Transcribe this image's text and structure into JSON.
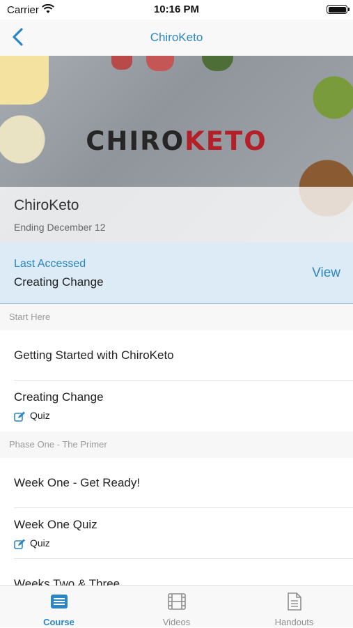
{
  "status_bar": {
    "carrier": "Carrier",
    "time": "10:16 PM"
  },
  "nav": {
    "title": "ChiroKeto"
  },
  "hero": {
    "logo_left": "CHIRO",
    "logo_right": "KETO",
    "course_name": "ChiroKeto",
    "ending": "Ending December 12"
  },
  "last_accessed": {
    "label": "Last Accessed",
    "value": "Creating Change",
    "action": "View"
  },
  "sections": [
    {
      "header": "Start Here",
      "items": [
        {
          "title": "Getting Started with ChiroKeto"
        },
        {
          "title": "Creating Change",
          "type": "Quiz"
        }
      ]
    },
    {
      "header": "Phase One - The Primer",
      "items": [
        {
          "title": "Week One - Get Ready!"
        },
        {
          "title": "Week One Quiz",
          "type": "Quiz"
        },
        {
          "title": "Weeks Two & Three"
        }
      ]
    }
  ],
  "tabs": [
    {
      "label": "Course",
      "icon": "list-icon",
      "active": true
    },
    {
      "label": "Videos",
      "icon": "film-icon",
      "active": false
    },
    {
      "label": "Handouts",
      "icon": "document-icon",
      "active": false
    }
  ],
  "colors": {
    "accent": "#2b86c5",
    "logo_red": "#b3202a",
    "highlight": "#dcebf5"
  }
}
